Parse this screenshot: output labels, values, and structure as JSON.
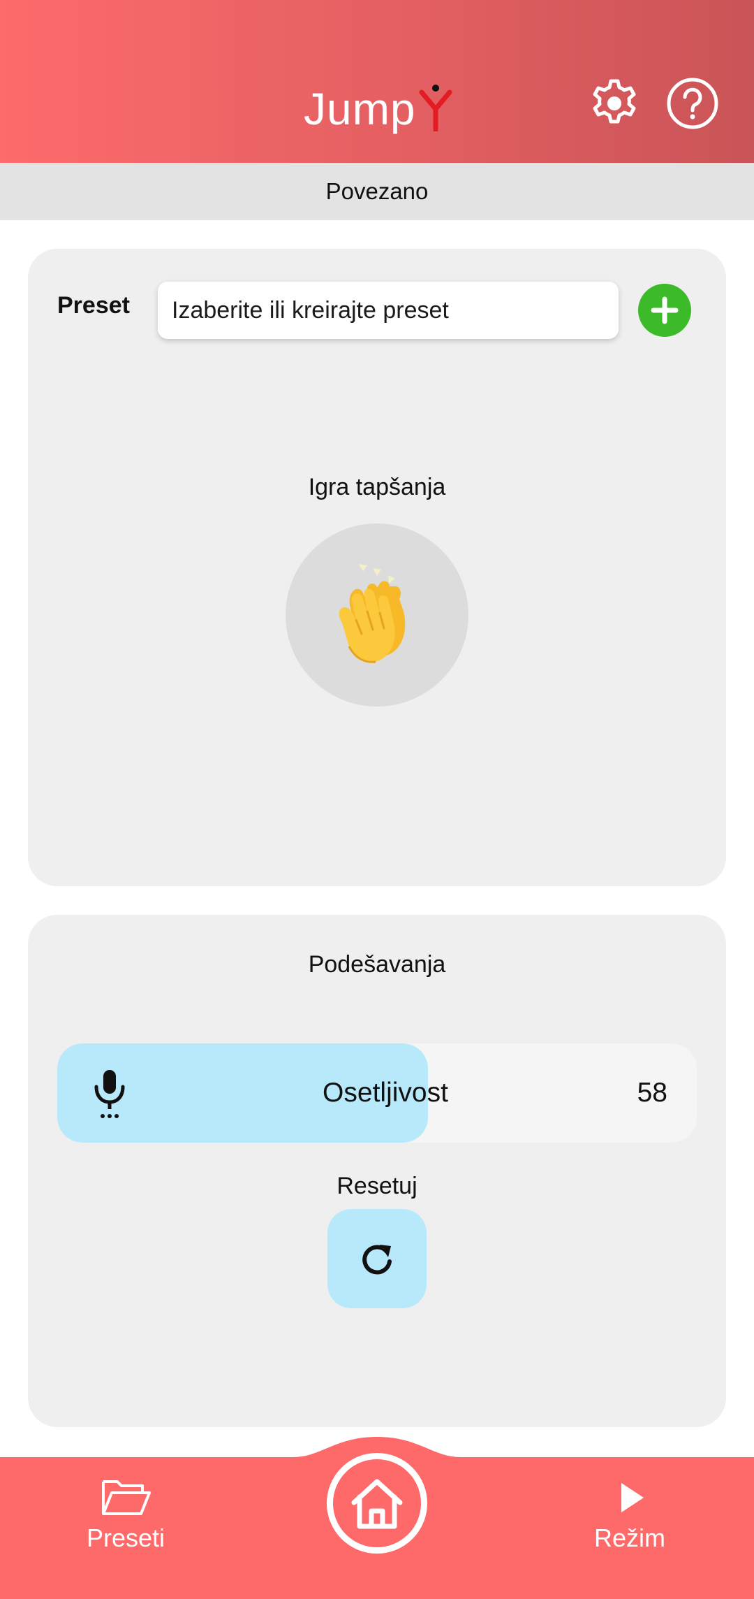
{
  "header": {
    "logo_text": "Jump",
    "logo_glyph": "Y",
    "settings_icon": "gear-icon",
    "help_icon": "question-icon",
    "gradient_start": "#fd6b6b",
    "gradient_end": "#c95457"
  },
  "status": {
    "text": "Povezano"
  },
  "preset": {
    "label": "Preset",
    "input_placeholder": "Izaberite ili kreirajte preset",
    "add_icon": "plus-icon",
    "add_color": "#3dba2a"
  },
  "game": {
    "title": "Igra tapšanja",
    "icon": "clapping-hands-icon"
  },
  "settings": {
    "title": "Podešavanja",
    "sensitivity": {
      "label": "Osetljivost",
      "value": "58",
      "fill_fraction": 0.58,
      "icon": "microphone-icon"
    },
    "reset": {
      "label": "Resetuj",
      "icon": "refresh-icon"
    },
    "accent": "#b8e9fb"
  },
  "bottom_nav": {
    "color": "#fe6a6a",
    "items": [
      {
        "label": "Preseti",
        "icon": "folder-icon"
      },
      {
        "label": "",
        "icon": "home-icon"
      },
      {
        "label": "Režim",
        "icon": "play-icon"
      }
    ]
  }
}
